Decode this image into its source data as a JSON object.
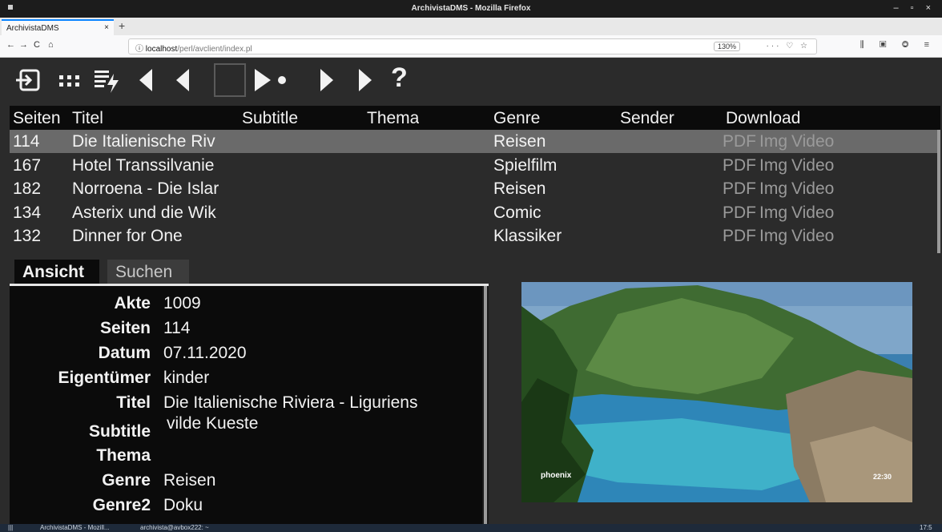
{
  "window": {
    "title": "ArchivistaDMS - Mozilla Firefox",
    "controls": "– ▫ ×"
  },
  "browser": {
    "tab_title": "ArchivistaDMS",
    "tab_close": "×",
    "new_tab": "+",
    "url_host": "localhost",
    "url_path": "/perl/avclient/index.pl",
    "zoom": "130%",
    "url_icons": "··· ♡ ☆",
    "nav": {
      "back": "←",
      "forward": "→",
      "reload": "C",
      "home": "⌂"
    },
    "right_tools": "⫼ ▣ ◎ ≡"
  },
  "toolbar": {
    "icons": [
      "login-icon",
      "grid-icon",
      "list-action-icon",
      "first-icon",
      "prev-icon",
      "page-box-icon",
      "play-next-icon",
      "next-icon",
      "last-icon",
      "help-icon"
    ],
    "help_label": "?"
  },
  "table": {
    "headers": {
      "seiten": "Seiten",
      "titel": "Titel",
      "subtitle": "Subtitle",
      "thema": "Thema",
      "genre": "Genre",
      "sender": "Sender",
      "download": "Download"
    },
    "rows": [
      {
        "seiten": "114",
        "titel": "Die Italienische Riv",
        "genre": "Reisen",
        "pdf": "PDF",
        "img": "Img",
        "video": "Video"
      },
      {
        "seiten": "167",
        "titel": "Hotel Transsilvanie",
        "genre": "Spielfilm",
        "pdf": "PDF",
        "img": "Img",
        "video": "Video"
      },
      {
        "seiten": "182",
        "titel": "Norroena - Die Islar",
        "genre": "Reisen",
        "pdf": "PDF",
        "img": "Img",
        "video": "Video"
      },
      {
        "seiten": "134",
        "titel": "Asterix und die Wik",
        "genre": "Comic",
        "pdf": "PDF",
        "img": "Img",
        "video": "Video"
      },
      {
        "seiten": "132",
        "titel": "Dinner for One",
        "genre": "Klassiker",
        "pdf": "PDF",
        "img": "Img",
        "video": "Video"
      }
    ],
    "selected_row": 0
  },
  "panel": {
    "tabs": {
      "ansicht": "Ansicht",
      "suchen": "Suchen"
    },
    "fields": {
      "akte": {
        "label": "Akte",
        "value": "1009"
      },
      "seiten": {
        "label": "Seiten",
        "value": "114"
      },
      "datum": {
        "label": "Datum",
        "value": "07.11.2020"
      },
      "eigentuemer": {
        "label": "Eigentümer",
        "value": "kinder"
      },
      "titel": {
        "label": "Titel",
        "value": "Die Italienische Riviera - Liguriens"
      },
      "subtitle": {
        "label": "Subtitle",
        "value": "vilde Kueste"
      },
      "thema": {
        "label": "Thema",
        "value": ""
      },
      "genre": {
        "label": "Genre",
        "value": "Reisen"
      },
      "genre2": {
        "label": "Genre2",
        "value": "Doku"
      }
    }
  },
  "video": {
    "logo": "phoenix",
    "time": "22:30"
  },
  "taskbar": {
    "item1": "ArchivistaDMS - Mozill...",
    "item2": "archivista@avbox222: ~",
    "clock": "17:5"
  }
}
